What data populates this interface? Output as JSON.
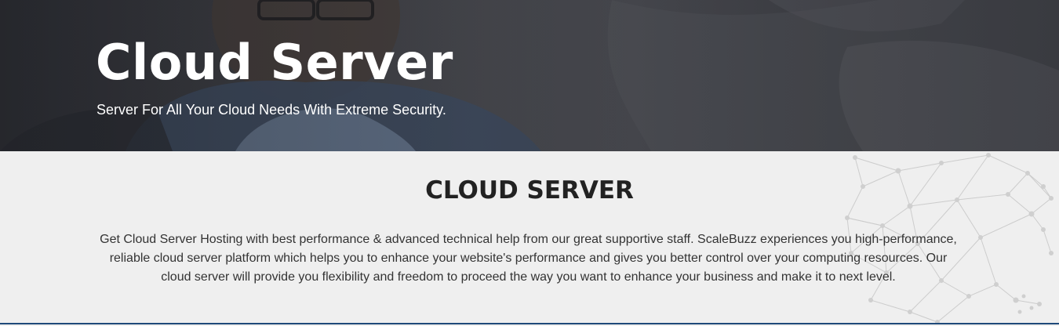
{
  "hero": {
    "title": "Cloud Server",
    "subtitle": "Server For All Your Cloud Needs With Extreme Security."
  },
  "section": {
    "title": "CLOUD SERVER",
    "body": "Get Cloud Server Hosting with best performance & advanced technical help from our great supportive staff. ScaleBuzz experiences you high-performance, reliable cloud server platform which helps you to enhance your website's performance and gives you better control over your computing resources. Our cloud server will provide you flexibility and freedom to proceed the way you want to enhance your business and make it to next level."
  },
  "colors": {
    "hero_background": "#3b3c41",
    "content_background": "#efefef",
    "heading_text": "#222222",
    "body_text": "#333333",
    "accent_rule": "#1f4a7a"
  }
}
